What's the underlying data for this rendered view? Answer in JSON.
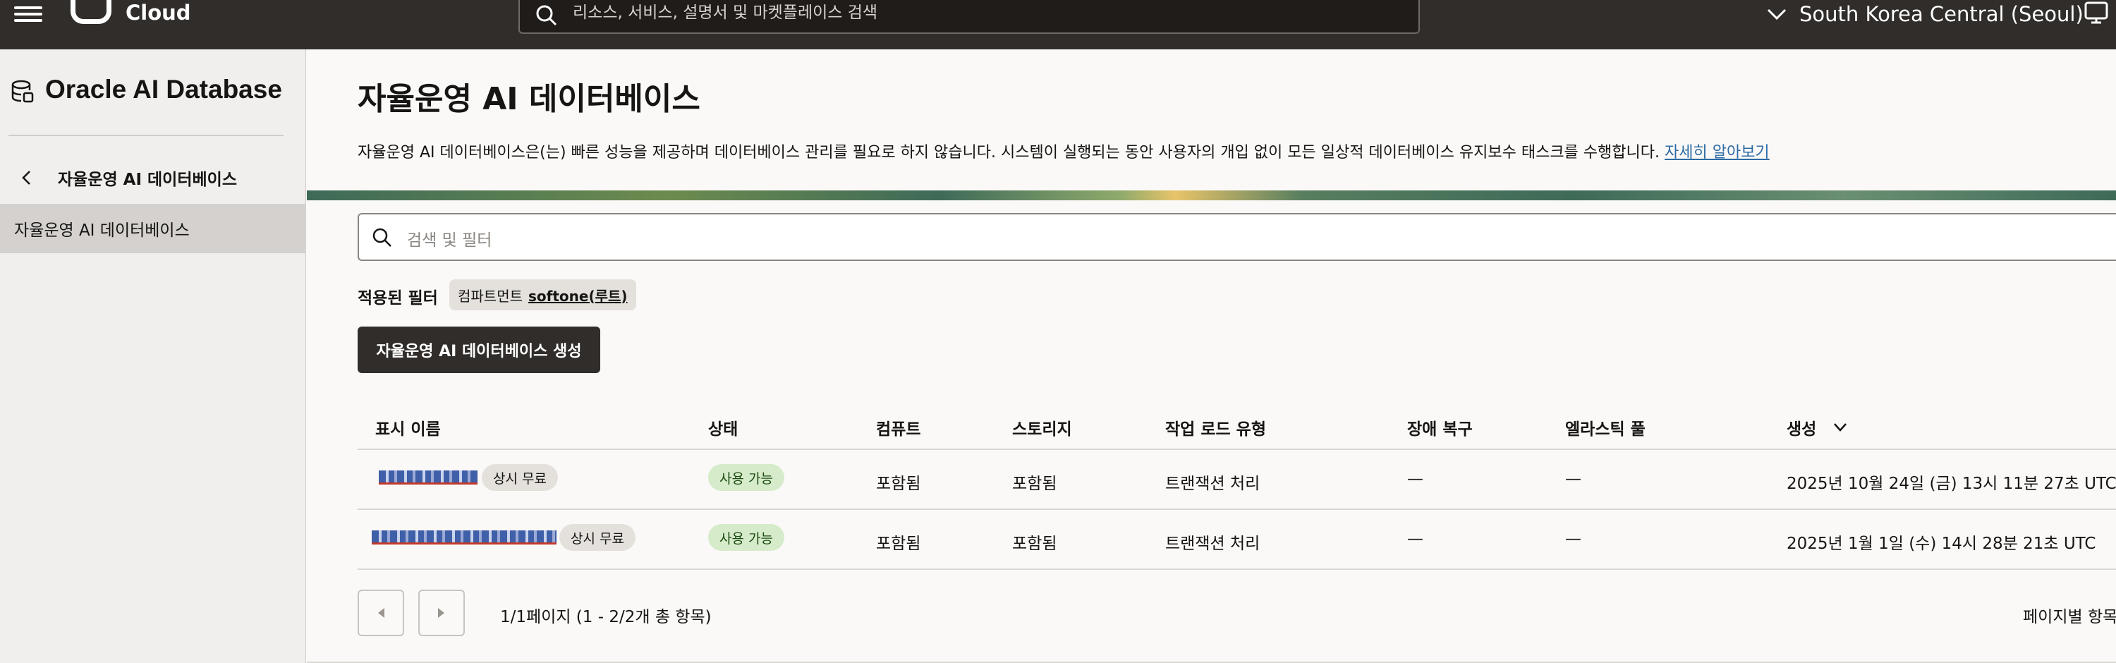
{
  "topbar": {
    "brand": "Cloud",
    "search_placeholder": "리소스, 서비스, 설명서 및 마켓플레이스 검색",
    "region": "South Korea Central (Seoul)"
  },
  "sidebar": {
    "title": "Oracle AI Database",
    "back_label": "자율운영 AI 데이터베이스",
    "items": [
      {
        "label": "자율운영 AI 데이터베이스"
      }
    ]
  },
  "main": {
    "title": "자율운영 AI 데이터베이스",
    "description": "자율운영 AI 데이터베이스은(는) 빠른 성능을 제공하며 데이터베이스 관리를 필요로 하지 않습니다. 시스템이 실행되는 동안 사용자의 개입 없이 모든 일상적 데이터베이스 유지보수 태스크를 수행합니다.",
    "learn_more": "자세히 알아보기",
    "filter_placeholder": "검색 및 필터",
    "applied_filters_label": "적용된 필터",
    "filter_chip": {
      "key": "컴파트먼트",
      "value": "softone(루트)"
    },
    "create_button": "자율운영 AI 데이터베이스 생성"
  },
  "table": {
    "headers": [
      "표시 이름",
      "상태",
      "컴퓨트",
      "스토리지",
      "작업 로드 유형",
      "장애 복구",
      "엘라스틱 풀",
      "생성"
    ],
    "rows": [
      {
        "badge": "상시 무료",
        "status": "사용 가능",
        "compute": "포함됨",
        "storage": "포함됨",
        "workload": "트랜잭션 처리",
        "dr": "—",
        "pool": "—",
        "created": "2025년 10월 24일 (금) 13시 11분 27초 UTC"
      },
      {
        "badge": "상시 무료",
        "status": "사용 가능",
        "compute": "포함됨",
        "storage": "포함됨",
        "workload": "트랜잭션 처리",
        "dr": "—",
        "pool": "—",
        "created": "2025년 1월 1일 (수) 14시 28분 21초 UTC"
      }
    ]
  },
  "pagination": {
    "summary": "1/1페이지 (1 - 2/2개 총 항목)",
    "per_page_label": "페이지별 항목"
  }
}
